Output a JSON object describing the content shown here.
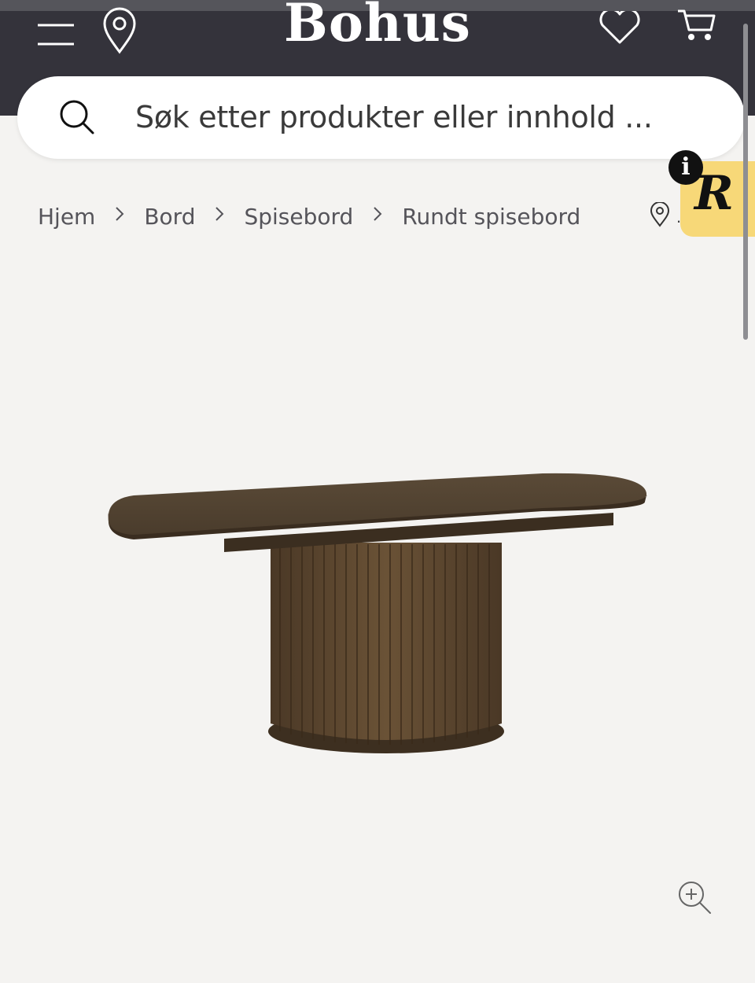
{
  "header": {
    "logo": "Bohus",
    "menu_icon": "menu-icon",
    "location_icon": "location-pin-icon",
    "wishlist_icon": "heart-icon",
    "cart_icon": "cart-icon"
  },
  "search": {
    "placeholder": "Søk etter produkter eller innhold ...",
    "icon": "search-icon"
  },
  "breadcrumb": {
    "items": [
      "Hjem",
      "Bord",
      "Spisebord",
      "Rundt spisebord"
    ],
    "separator_icon": "chevron-right-icon",
    "store_icon": "location-pin-icon",
    "store_text": "."
  },
  "review_widget": {
    "letter": "R",
    "info_label": "i",
    "color": "#f7d878"
  },
  "product": {
    "image_icon": "dining-table-image",
    "zoom_icon": "zoom-in-icon"
  },
  "colors": {
    "header_bg": "#34333b",
    "page_bg": "#f4f3f1",
    "text": "#55545a"
  }
}
